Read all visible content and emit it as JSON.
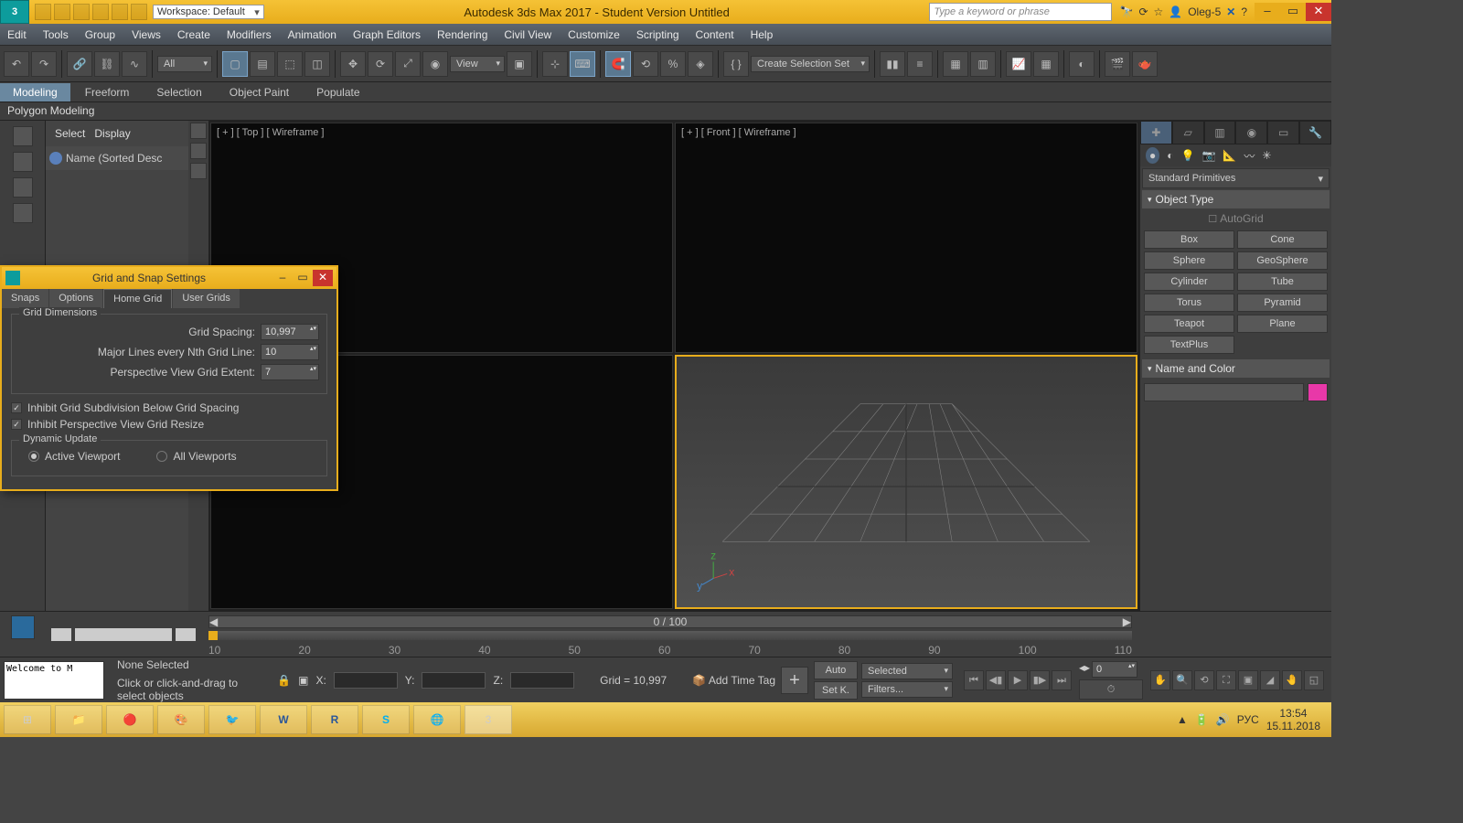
{
  "titlebar": {
    "workspace": "Workspace: Default",
    "app": "Autodesk 3ds Max 2017 - Student Version   Untitled",
    "search_placeholder": "Type a keyword or phrase",
    "user": "Oleg-5"
  },
  "menus": [
    "Edit",
    "Tools",
    "Group",
    "Views",
    "Create",
    "Modifiers",
    "Animation",
    "Graph Editors",
    "Rendering",
    "Civil View",
    "Customize",
    "Scripting",
    "Content",
    "Help"
  ],
  "toolbar": {
    "dd1": "All",
    "dd2": "View",
    "dd3": "Create Selection Set"
  },
  "tabs": [
    "Modeling",
    "Freeform",
    "Selection",
    "Object Paint",
    "Populate"
  ],
  "subtab": "Polygon Modeling",
  "scene": {
    "tabs": [
      "Select",
      "Display"
    ],
    "header": "Name (Sorted Desc"
  },
  "viewports": {
    "topleft": "[ + ]  [ Top ]  [ Wireframe ]",
    "topright": "[ + ]  [ Front ]  [ Wireframe ]"
  },
  "cmd": {
    "category": "Standard Primitives",
    "roll1": "Object Type",
    "autogrid": "AutoGrid",
    "prims": [
      "Box",
      "Cone",
      "Sphere",
      "GeoSphere",
      "Cylinder",
      "Tube",
      "Torus",
      "Pyramid",
      "Teapot",
      "Plane",
      "TextPlus"
    ],
    "roll2": "Name and Color"
  },
  "timeslider": {
    "label": "0 / 100",
    "ticks": [
      "10",
      "20",
      "30",
      "40",
      "50",
      "60",
      "70",
      "80",
      "90",
      "100",
      "110"
    ]
  },
  "status": {
    "welcome": "Welcome to M",
    "line1": "None Selected",
    "line2": "Click or click-and-drag to select objects",
    "x": "X:",
    "y": "Y:",
    "z": "Z:",
    "grid": "Grid = 10,997",
    "addtime": "Add Time Tag",
    "auto": "Auto",
    "setk": "Set K.",
    "selected": "Selected",
    "filters": "Filters...",
    "zero": "0"
  },
  "dialog": {
    "title": "Grid and Snap Settings",
    "tabs": [
      "Snaps",
      "Options",
      "Home Grid",
      "User Grids"
    ],
    "fs1": "Grid Dimensions",
    "f1": "Grid Spacing:",
    "v1": "10,997",
    "f2": "Major Lines every Nth Grid Line:",
    "v2": "10",
    "f3": "Perspective View Grid Extent:",
    "v3": "7",
    "chk1": "Inhibit Grid Subdivision Below Grid Spacing",
    "chk2": "Inhibit Perspective View Grid Resize",
    "fs2": "Dynamic Update",
    "r1": "Active Viewport",
    "r2": "All Viewports"
  },
  "taskbar": {
    "lang": "РУС",
    "time": "13:54",
    "date": "15.11.2018"
  }
}
